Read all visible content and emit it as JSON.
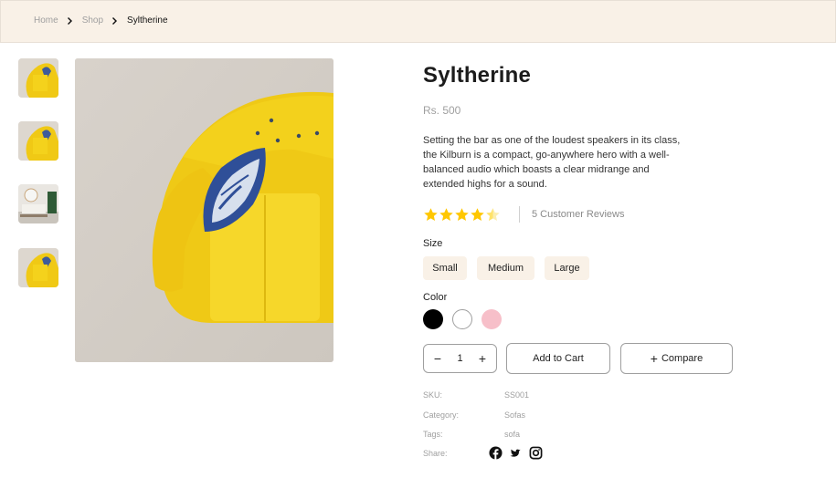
{
  "breadcrumb": {
    "items": [
      "Home",
      "Shop",
      "Syltherine"
    ],
    "separator_icon": "chevron-right-icon"
  },
  "gallery": {
    "thumbnails": [
      "sofa-top-view",
      "sofa-top-view",
      "living-room",
      "sofa-top-view"
    ],
    "main_image": "yellow-sofa-with-pillow"
  },
  "product": {
    "title": "Syltherine",
    "price": "Rs. 500",
    "description": "Setting the bar as one of the loudest speakers in its class, the Kilburn is a compact, go-anywhere hero with a well-balanced audio which boasts a clear midrange and extended highs for a sound.",
    "rating": 4.5,
    "rating_max": 5,
    "reviews_text": "5 Customer Reviews"
  },
  "size": {
    "label": "Size",
    "options": [
      "Small",
      "Medium",
      "Large"
    ]
  },
  "color": {
    "label": "Color",
    "options": [
      "#000000",
      "#ffffff",
      "#f7bfc9"
    ]
  },
  "cart": {
    "quantity": "1",
    "minus": "−",
    "plus": "+",
    "add_to_cart": "Add to Cart",
    "compare_icon": "+",
    "compare": "Compare"
  },
  "meta": {
    "sku_label": "SKU:",
    "sku_value": "SS001",
    "category_label": "Category:",
    "category_value": "Sofas",
    "tags_label": "Tags:",
    "tags_value": "sofa",
    "share_label": "Share:",
    "share_icons": [
      "facebook-icon",
      "twitter-icon",
      "instagram-icon"
    ]
  },
  "colors": {
    "topbar_bg": "#f9f1e7",
    "star": "#ffc700",
    "accent_yellow": "#f2d21b"
  }
}
